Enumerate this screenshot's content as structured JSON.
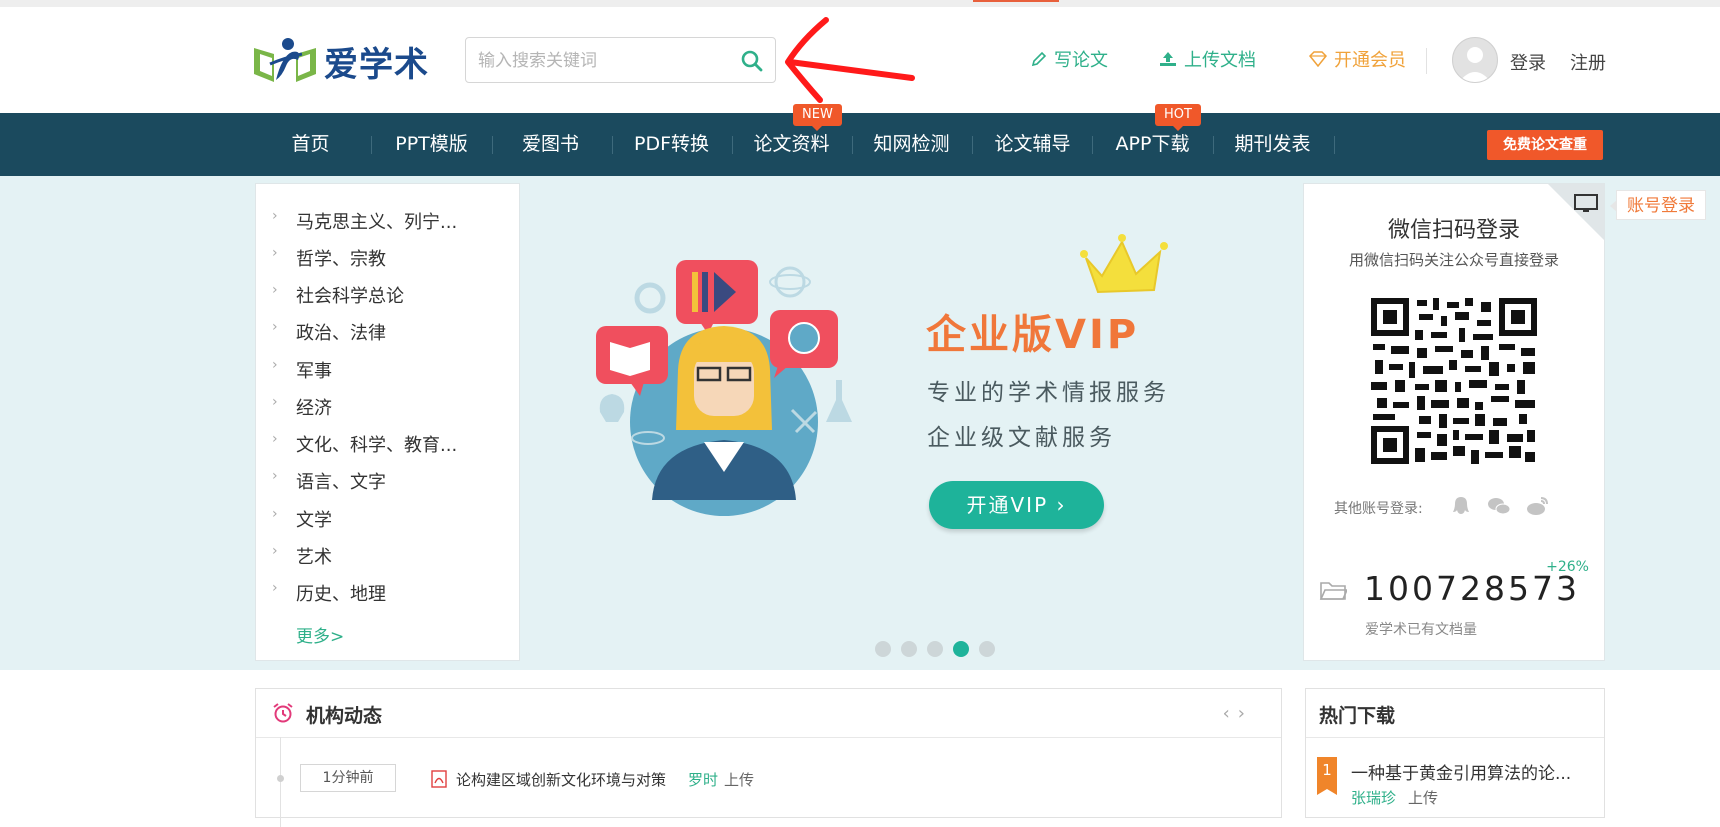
{
  "logo": {
    "text": "爱学术"
  },
  "search": {
    "placeholder": "输入搜索关键词"
  },
  "header_links": {
    "write_paper": "写论文",
    "upload_doc": "上传文档",
    "vip": "开通会员",
    "login": "登录",
    "register": "注册"
  },
  "nav": {
    "items": [
      "首页",
      "PPT模版",
      "爱图书",
      "PDF转换",
      "论文资料",
      "知网检测",
      "论文辅导",
      "APP下载",
      "期刊发表"
    ],
    "badge_new": "NEW",
    "badge_hot": "HOT",
    "free_check": "免费论文查重"
  },
  "categories": {
    "items": [
      "马克思主义、列宁...",
      "哲学、宗教",
      "社会科学总论",
      "政治、法律",
      "军事",
      "经济",
      "文化、科学、教育...",
      "语言、文字",
      "文学",
      "艺术",
      "历史、地理"
    ],
    "more": "更多>"
  },
  "banner": {
    "title": "企业版VIP",
    "line1": "专业的学术情报服务",
    "line2": "企业级文献服务",
    "button": "开通VIP ›",
    "active_dot": 4,
    "dot_count": 5
  },
  "login_panel": {
    "account_login": "账号登录",
    "title": "微信扫码登录",
    "subtitle": "用微信扫码关注公众号直接登录",
    "other_login": "其他账号登录:",
    "growth": "+26%",
    "doc_count": "100728573",
    "doc_count_label": "爱学术已有文档量"
  },
  "news": {
    "title": "机构动态",
    "time": "1分钟前",
    "doc": "论构建区域创新文化环境与对策",
    "user": "罗时",
    "action": "上传"
  },
  "hot": {
    "title": "热门下载",
    "rank": "1",
    "doc": "一种基于黄金引用算法的论...",
    "user": "张瑞珍",
    "action": "上传"
  },
  "colors": {
    "nav_bg": "#1b4a5e",
    "accent_green": "#1eb39a",
    "accent_orange": "#f0582a",
    "banner_bg": "#e4f2f4"
  }
}
